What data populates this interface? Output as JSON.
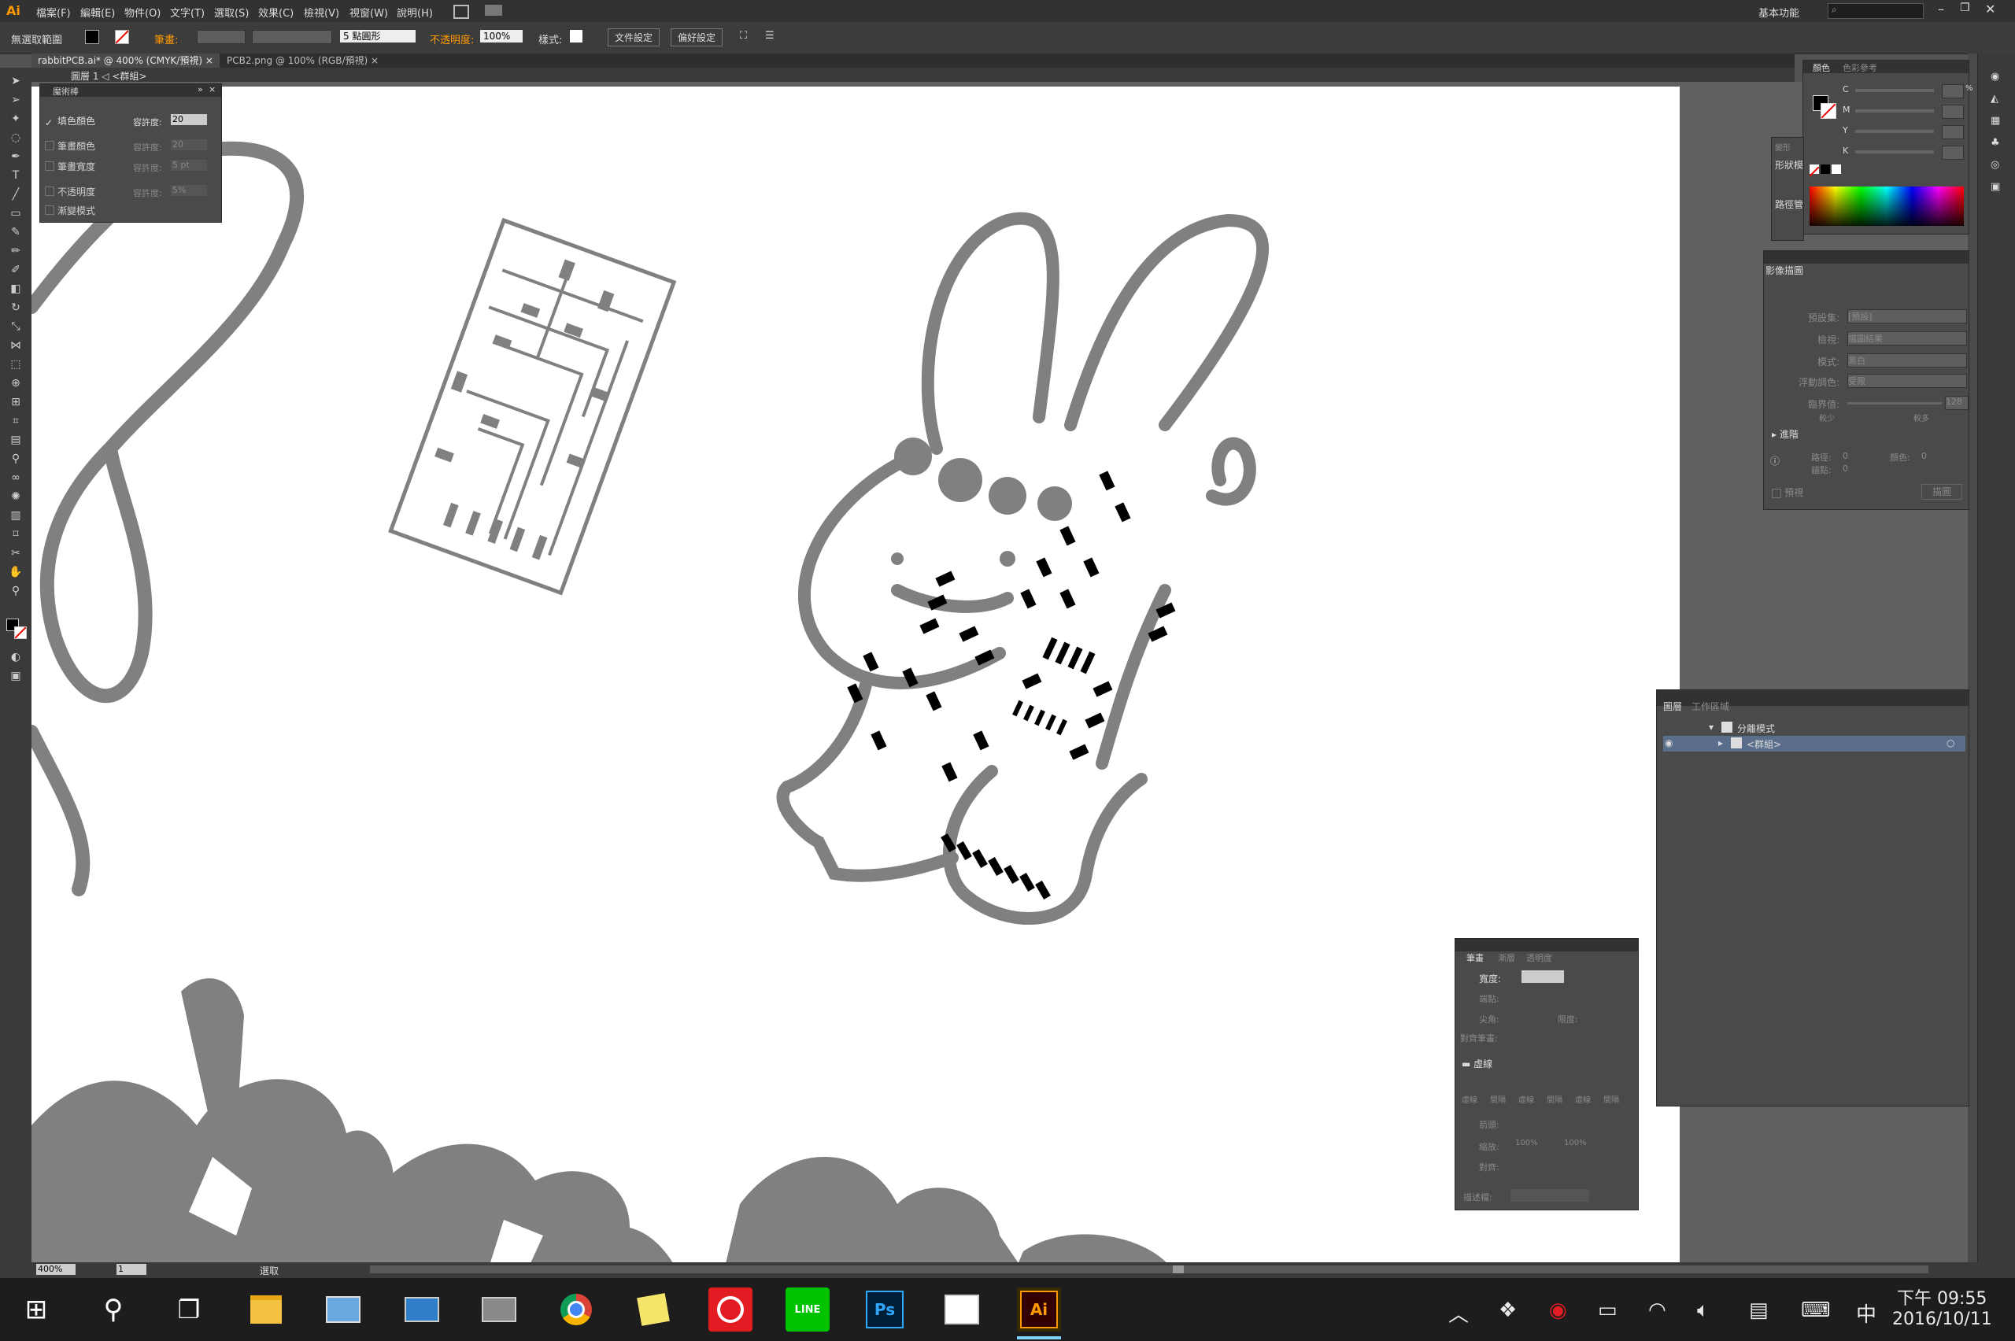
{
  "menubar": {
    "logo": "Ai",
    "items": [
      "檔案(F)",
      "編輯(E)",
      "物件(O)",
      "文字(T)",
      "選取(S)",
      "效果(C)",
      "檢視(V)",
      "視窗(W)",
      "說明(H)"
    ],
    "workspace": "基本功能"
  },
  "controlbar": {
    "selection_state": "無選取範圍",
    "stroke_label": "筆畫:",
    "brush_size": "5 點圓形",
    "opacity_label": "不透明度:",
    "opacity_value": "100%",
    "style_label": "樣式:",
    "doc_setup": "文件設定",
    "preferences": "偏好設定"
  },
  "tabs": [
    {
      "label": "rabbitPCB.ai* @ 400% (CMYK/預視)",
      "close": "×"
    },
    {
      "label": "PCB2.png @ 100% (RGB/預視)",
      "close": "×"
    }
  ],
  "breadcrumb": {
    "text": "圖層 1  ◁  <群組>"
  },
  "magic_wand": {
    "title": "魔術棒",
    "rows": [
      {
        "checked": true,
        "label": "填色顏色",
        "tol_label": "容許度:",
        "value": "20"
      },
      {
        "checked": false,
        "label": "筆畫顏色",
        "tol_label": "容許度:",
        "value": "20"
      },
      {
        "checked": false,
        "label": "筆畫寬度",
        "tol_label": "容許度:",
        "value": "5 pt"
      },
      {
        "checked": false,
        "label": "不透明度",
        "tol_label": "容許度:",
        "value": "5%"
      },
      {
        "checked": false,
        "label": "漸變模式",
        "tol_label": "",
        "value": ""
      }
    ]
  },
  "color_panel": {
    "tabs": [
      "顏色",
      "色彩參考"
    ],
    "channels": [
      "C",
      "M",
      "Y",
      "K"
    ],
    "unit": "%"
  },
  "shape_panel": {
    "labels": [
      "變形",
      "形狀模",
      "路徑管"
    ]
  },
  "image_trace": {
    "title": "影像描圖",
    "rows": [
      {
        "label": "預設集:",
        "value": "[預設]"
      },
      {
        "label": "檢視:",
        "value": "描圖結果"
      },
      {
        "label": "模式:",
        "value": "黑白"
      },
      {
        "label": "浮動調色:",
        "value": "受限"
      },
      {
        "label": "臨界值:",
        "value": "128"
      }
    ],
    "threshold_min": "較少",
    "threshold_max": "較多",
    "advanced": "進階",
    "paths_label": "路徑:",
    "paths_value": "0",
    "anchors_label": "錨點:",
    "anchors_value": "0",
    "colors_label": "顏色:",
    "colors_value": "0",
    "preview": "預視",
    "trace_button": "描圖"
  },
  "layers_panel": {
    "tabs": [
      "圖層",
      "工作區域"
    ],
    "items": [
      {
        "label": "分離模式"
      },
      {
        "label": "<群組>"
      }
    ]
  },
  "stroke_panel": {
    "tabs": [
      "筆畫",
      "漸層",
      "透明度"
    ],
    "width_label": "寬度:",
    "cap_label": "端點:",
    "corner_label": "尖角:",
    "limit_label": "限度:",
    "align_label": "對齊筆畫:",
    "dashed_label": "虛線",
    "dash_labels": [
      "虛線",
      "間隔",
      "虛線",
      "間隔",
      "虛線",
      "間隔"
    ],
    "arrow_label": "箭頭:",
    "scale_label": "縮放:",
    "scale_a": "100%",
    "scale_b": "100%",
    "align2_label": "對齊:",
    "profile_label": "描述檔:"
  },
  "statusbar": {
    "zoom": "400%",
    "page": "1",
    "tool": "選取"
  },
  "taskbar": {
    "time": "下午 09:55",
    "date": "2016/10/11",
    "ime": "中"
  },
  "colors": {
    "accent": "#ff9a00",
    "artwork_gray": "#808080",
    "pcb_black": "#000000",
    "taskbar": "#1d1d1d"
  }
}
